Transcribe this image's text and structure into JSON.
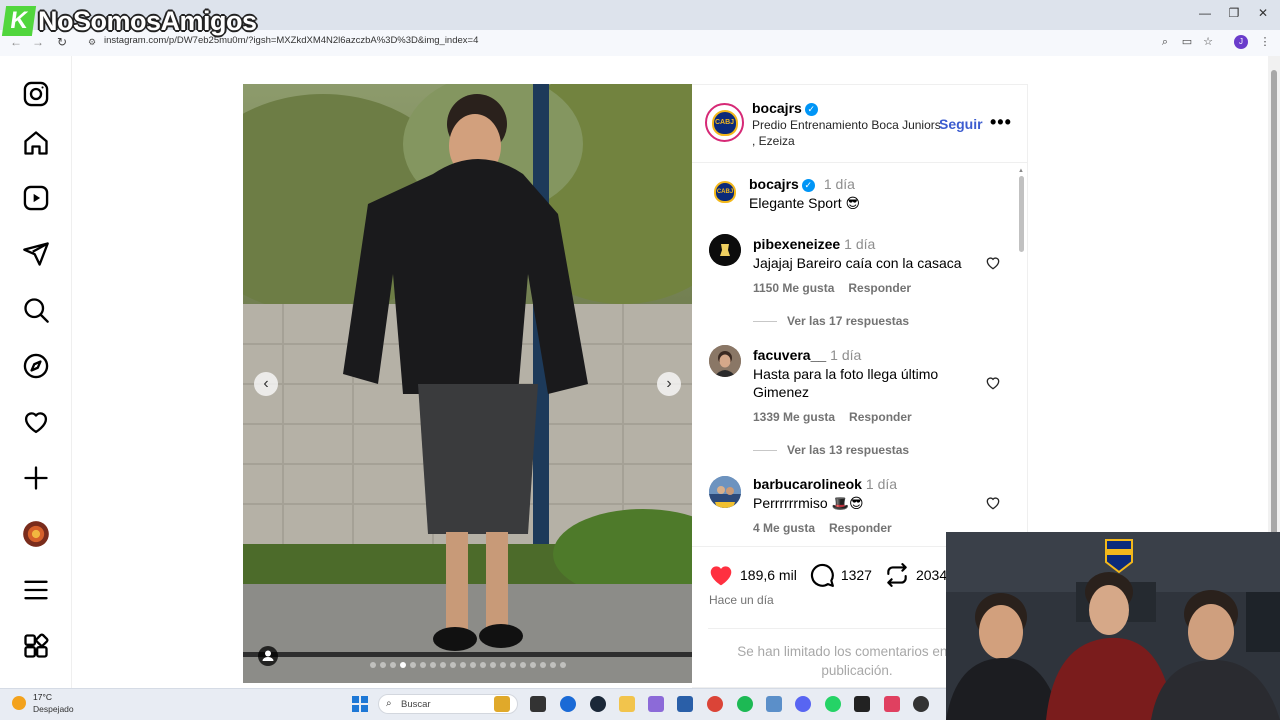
{
  "browser": {
    "url": "instagram.com/p/DW7eb25mu0m/?igsh=MXZkdXM4N2l6azczbA%3D%3D&img_index=4",
    "window_controls": {
      "minimize": "—",
      "maximize": "❐",
      "close": "✕"
    },
    "nav": {
      "back": "←",
      "forward": "→",
      "reload": "↻"
    },
    "profile_initial": "J"
  },
  "watermark": {
    "k": "K",
    "text": "NoSomosAmigos"
  },
  "sidebar": {
    "items": [
      "instagram-logo",
      "home",
      "reels",
      "messages",
      "search",
      "explore",
      "notifications",
      "create",
      "profile",
      "more",
      "also-from-meta"
    ]
  },
  "post": {
    "carousel": {
      "prev": "‹",
      "next": "›",
      "dots_total": 20,
      "active_dot": 3
    },
    "header": {
      "username": "bocajrs",
      "location": "Predio Entrenamiento Boca Juniors , Ezeiza",
      "follow_label": "Seguir",
      "more_label": "•••",
      "crest_text": "CABJ"
    },
    "caption": {
      "username": "bocajrs",
      "time": "1 día",
      "text": "Elegante Sport 😎"
    },
    "comments": [
      {
        "username": "pibexeneizee",
        "time": "1 día",
        "text": "Jajajaj Bareiro caía con la casaca",
        "likes": "1150 Me gusta",
        "reply": "Responder",
        "replies": "Ver las 17 respuestas"
      },
      {
        "username": "facuvera__",
        "time": "1 día",
        "text": "Hasta para la foto llega último Gimenez",
        "likes": "1339 Me gusta",
        "reply": "Responder",
        "replies": "Ver las 13 respuestas"
      },
      {
        "username": "barbucarolineok",
        "time": "1 día",
        "text": "Perrrrrrmiso 🎩😎",
        "likes": "4 Me gusta",
        "reply": "Responder"
      }
    ],
    "actions": {
      "likes": "189,6 mil",
      "comments": "1327",
      "reposts": "2034"
    },
    "date": "Hace un día",
    "comments_limited": "Se han limitado los comentarios en esta publicación."
  },
  "taskbar": {
    "weather_temp": "17°C",
    "weather_desc": "Despejado",
    "search_placeholder": "Buscar"
  },
  "colors": {
    "like_red": "#ff3040",
    "link_blue": "#3c5ccf",
    "verified_blue": "#0095f6",
    "boca_blue": "#0b2a7a",
    "boca_gold": "#f3b81b"
  }
}
